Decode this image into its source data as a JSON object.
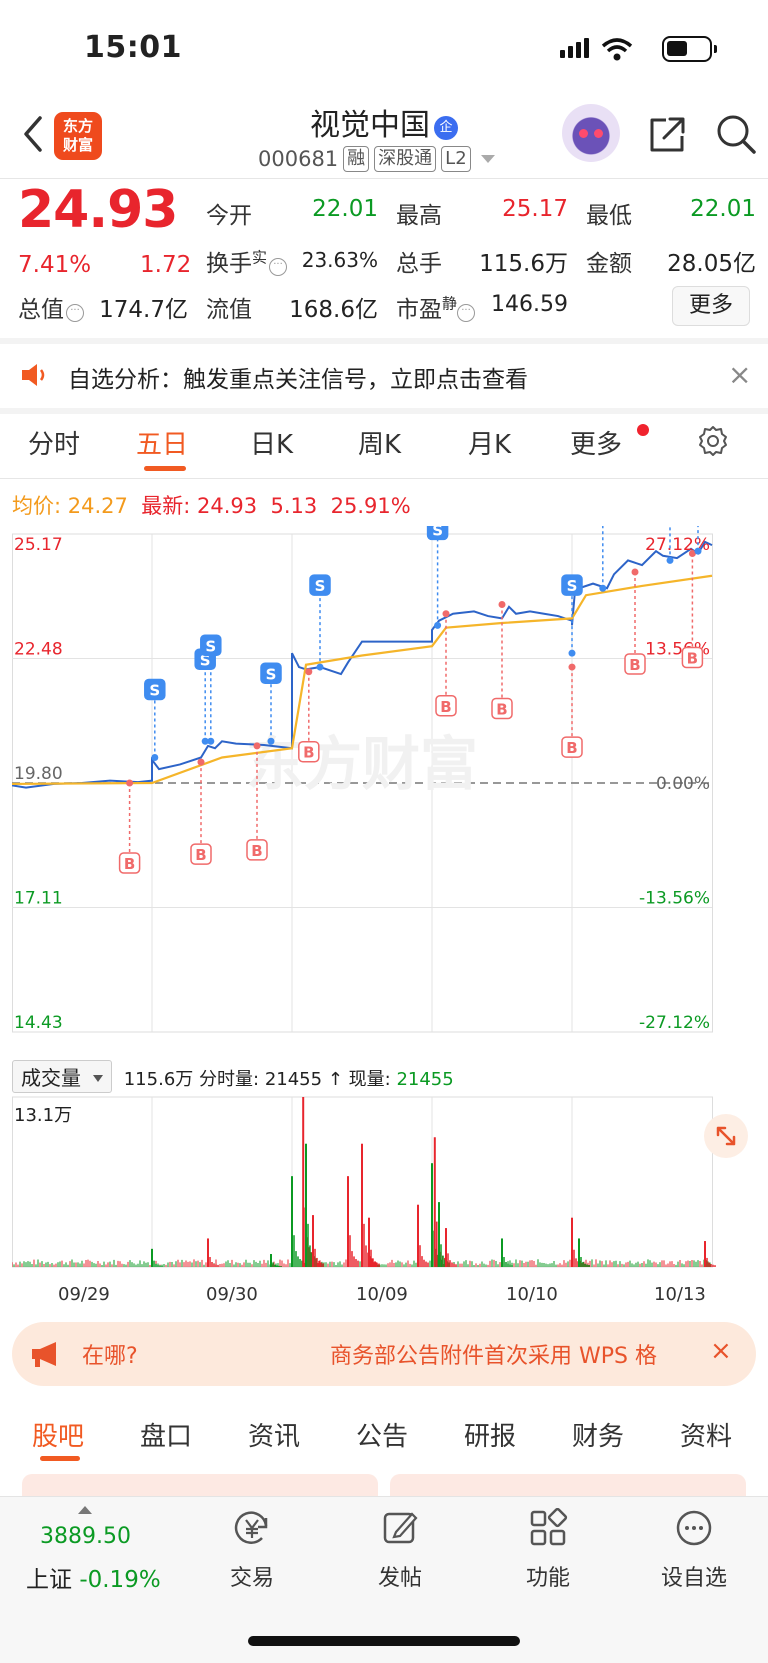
{
  "status_bar": {
    "time": "15:01"
  },
  "header": {
    "logo_line1": "东方",
    "logo_line2": "财富",
    "stock_name": "视觉中国",
    "badge": "企",
    "code": "000681",
    "tags": [
      "融",
      "深股通",
      "L2"
    ]
  },
  "quote": {
    "price": "24.93",
    "pct": "7.41%",
    "change": "1.72",
    "rows": [
      [
        {
          "label": "今开",
          "value": "22.01",
          "color": "green"
        },
        {
          "label": "最高",
          "value": "25.17",
          "color": "red"
        },
        {
          "label": "最低",
          "value": "22.01",
          "color": "green"
        }
      ],
      [
        {
          "label": "换手",
          "sup": "实",
          "value": "23.63%",
          "color": "plain"
        },
        {
          "label": "总手",
          "value": "115.6万",
          "color": "plain"
        },
        {
          "label": "金额",
          "value": "28.05亿",
          "color": "plain"
        }
      ]
    ],
    "row3": {
      "total_cap_label": "总值",
      "total_cap": "174.7亿",
      "float_cap_label": "流值",
      "float_cap": "168.6亿",
      "pe_label": "市盈",
      "pe_sup": "静",
      "pe": "146.59"
    },
    "more_label": "更多"
  },
  "notice": {
    "text": "自选分析：触发重点关注信号，立即点击查看",
    "close": "×"
  },
  "tabs": [
    {
      "label": "分时",
      "active": false
    },
    {
      "label": "五日",
      "active": true
    },
    {
      "label": "日K",
      "active": false
    },
    {
      "label": "周K",
      "active": false
    },
    {
      "label": "月K",
      "active": false
    },
    {
      "label": "更多",
      "active": false
    }
  ],
  "info_line": {
    "avg_label": "均价:",
    "avg": "24.27",
    "latest_label": "最新:",
    "latest": "24.93",
    "change": "5.13",
    "pct": "25.91%"
  },
  "chart_data": {
    "type": "line",
    "title": "",
    "x_dates": [
      "09/29",
      "09/30",
      "10/09",
      "10/10",
      "10/13"
    ],
    "ylim": [
      14.43,
      25.17
    ],
    "prev_close": 19.8,
    "left_ticks": [
      "25.17",
      "22.48",
      "19.80",
      "17.11",
      "14.43"
    ],
    "right_ticks": [
      "27.12%",
      "13.56%",
      "0.00%",
      "-13.56%",
      "-27.12%"
    ],
    "colors": {
      "price": "#2d64c8",
      "avg": "#f5b52a",
      "buy": "#f06a6a",
      "sell": "#3f8cf0",
      "up": "#e8252d",
      "down": "#0b9a23"
    },
    "series": [
      {
        "name": "价格",
        "x": [
          0,
          0.1,
          0.3,
          0.5,
          0.7,
          0.9,
          1.0,
          1.0,
          1.05,
          1.2,
          1.35,
          1.4,
          1.45,
          1.5,
          1.6,
          1.8,
          2.0,
          2.0,
          2.05,
          2.1,
          2.2,
          2.35,
          2.4,
          2.5,
          2.6,
          2.8,
          3.0,
          3.0,
          3.05,
          3.15,
          3.3,
          3.4,
          3.5,
          3.55,
          3.6,
          3.7,
          3.8,
          3.9,
          4.0,
          4.0,
          4.02,
          4.05,
          4.15,
          4.25,
          4.3,
          4.4,
          4.5,
          4.6,
          4.65,
          4.75,
          4.85,
          4.9,
          4.95,
          5.0
        ],
        "values": [
          19.75,
          19.7,
          19.78,
          19.8,
          19.85,
          19.82,
          19.85,
          20.3,
          20.1,
          20.2,
          20.35,
          20.6,
          20.55,
          20.7,
          20.65,
          20.62,
          20.55,
          22.6,
          22.3,
          22.25,
          22.3,
          22.15,
          22.4,
          22.85,
          22.85,
          22.85,
          22.85,
          23.1,
          23.3,
          23.45,
          23.5,
          23.4,
          23.35,
          23.6,
          23.45,
          23.5,
          23.45,
          23.4,
          23.3,
          23.2,
          23.9,
          24.0,
          24.1,
          24.0,
          24.3,
          24.6,
          24.5,
          24.8,
          24.7,
          24.65,
          24.85,
          24.75,
          25.0,
          24.93
        ]
      },
      {
        "name": "均价",
        "x": [
          0,
          1.0,
          1.5,
          2.0,
          2.1,
          2.5,
          3.0,
          3.1,
          3.5,
          4.0,
          4.1,
          4.5,
          5.0
        ],
        "values": [
          19.78,
          19.8,
          20.35,
          20.55,
          22.35,
          22.55,
          22.75,
          23.15,
          23.25,
          23.35,
          23.85,
          24.05,
          24.27
        ]
      }
    ],
    "markers": [
      {
        "type": "B",
        "x": 0.84,
        "y": 19.8
      },
      {
        "type": "B",
        "x": 1.35,
        "y": 20.25
      },
      {
        "type": "B",
        "x": 1.75,
        "y": 20.6
      },
      {
        "type": "B",
        "x": 2.12,
        "y": 22.2
      },
      {
        "type": "B",
        "x": 3.1,
        "y": 23.45
      },
      {
        "type": "B",
        "x": 3.5,
        "y": 23.65
      },
      {
        "type": "B",
        "x": 4.0,
        "y": 22.3
      },
      {
        "type": "B",
        "x": 4.45,
        "y": 24.35
      },
      {
        "type": "B",
        "x": 4.86,
        "y": 24.75
      },
      {
        "type": "S",
        "x": 1.02,
        "y": 20.35
      },
      {
        "type": "S",
        "x": 1.38,
        "y": 20.7
      },
      {
        "type": "S",
        "x": 1.42,
        "y": 20.7
      },
      {
        "type": "S",
        "x": 1.85,
        "y": 20.7
      },
      {
        "type": "S",
        "x": 2.2,
        "y": 22.3
      },
      {
        "type": "S",
        "x": 3.04,
        "y": 23.2
      },
      {
        "type": "S",
        "x": 4.0,
        "y": 22.6
      },
      {
        "type": "S",
        "x": 4.22,
        "y": 24.0
      },
      {
        "type": "S",
        "x": 4.7,
        "y": 24.6
      },
      {
        "type": "S",
        "x": 4.9,
        "y": 24.8
      }
    ]
  },
  "volume": {
    "selector": "成交量",
    "total": "115.6万",
    "tick_label": "分时量:",
    "tick_value": "21455",
    "arrow": "↑",
    "now_label": "现量:",
    "now_value": "21455",
    "max_label": "13.1万",
    "chart_data": {
      "type": "bar",
      "ylim": [
        0,
        131000
      ],
      "spikes": [
        {
          "x": 1.0,
          "v": 14000,
          "c": "down"
        },
        {
          "x": 1.4,
          "v": 22000,
          "c": "up"
        },
        {
          "x": 1.85,
          "v": 10000,
          "c": "down"
        },
        {
          "x": 2.0,
          "v": 70000,
          "c": "down"
        },
        {
          "x": 2.08,
          "v": 131000,
          "c": "up"
        },
        {
          "x": 2.1,
          "v": 95000,
          "c": "down"
        },
        {
          "x": 2.15,
          "v": 40000,
          "c": "up"
        },
        {
          "x": 2.4,
          "v": 70000,
          "c": "up"
        },
        {
          "x": 2.5,
          "v": 95000,
          "c": "up"
        },
        {
          "x": 2.55,
          "v": 38000,
          "c": "up"
        },
        {
          "x": 2.9,
          "v": 48000,
          "c": "up"
        },
        {
          "x": 3.0,
          "v": 80000,
          "c": "down"
        },
        {
          "x": 3.02,
          "v": 100000,
          "c": "up"
        },
        {
          "x": 3.05,
          "v": 50000,
          "c": "down"
        },
        {
          "x": 3.1,
          "v": 30000,
          "c": "up"
        },
        {
          "x": 3.5,
          "v": 22000,
          "c": "down"
        },
        {
          "x": 4.0,
          "v": 38000,
          "c": "up"
        },
        {
          "x": 4.05,
          "v": 22000,
          "c": "down"
        },
        {
          "x": 4.95,
          "v": 20000,
          "c": "up"
        }
      ]
    }
  },
  "ad": {
    "left_text": "在哪?",
    "right_text": "商务部公告附件首次采用 WPS 格",
    "close": "×"
  },
  "bottom_tabs": [
    "股吧",
    "盘口",
    "资讯",
    "公告",
    "研报",
    "财务",
    "资料"
  ],
  "toolbar": {
    "index_value": "3889.50",
    "index_name": "上证",
    "index_pct": "-0.19%",
    "items": [
      {
        "label": "交易",
        "icon": "yen-exchange-icon"
      },
      {
        "label": "发帖",
        "icon": "edit-icon"
      },
      {
        "label": "功能",
        "icon": "grid-icon"
      },
      {
        "label": "设自选",
        "icon": "more-circle-icon"
      }
    ]
  }
}
